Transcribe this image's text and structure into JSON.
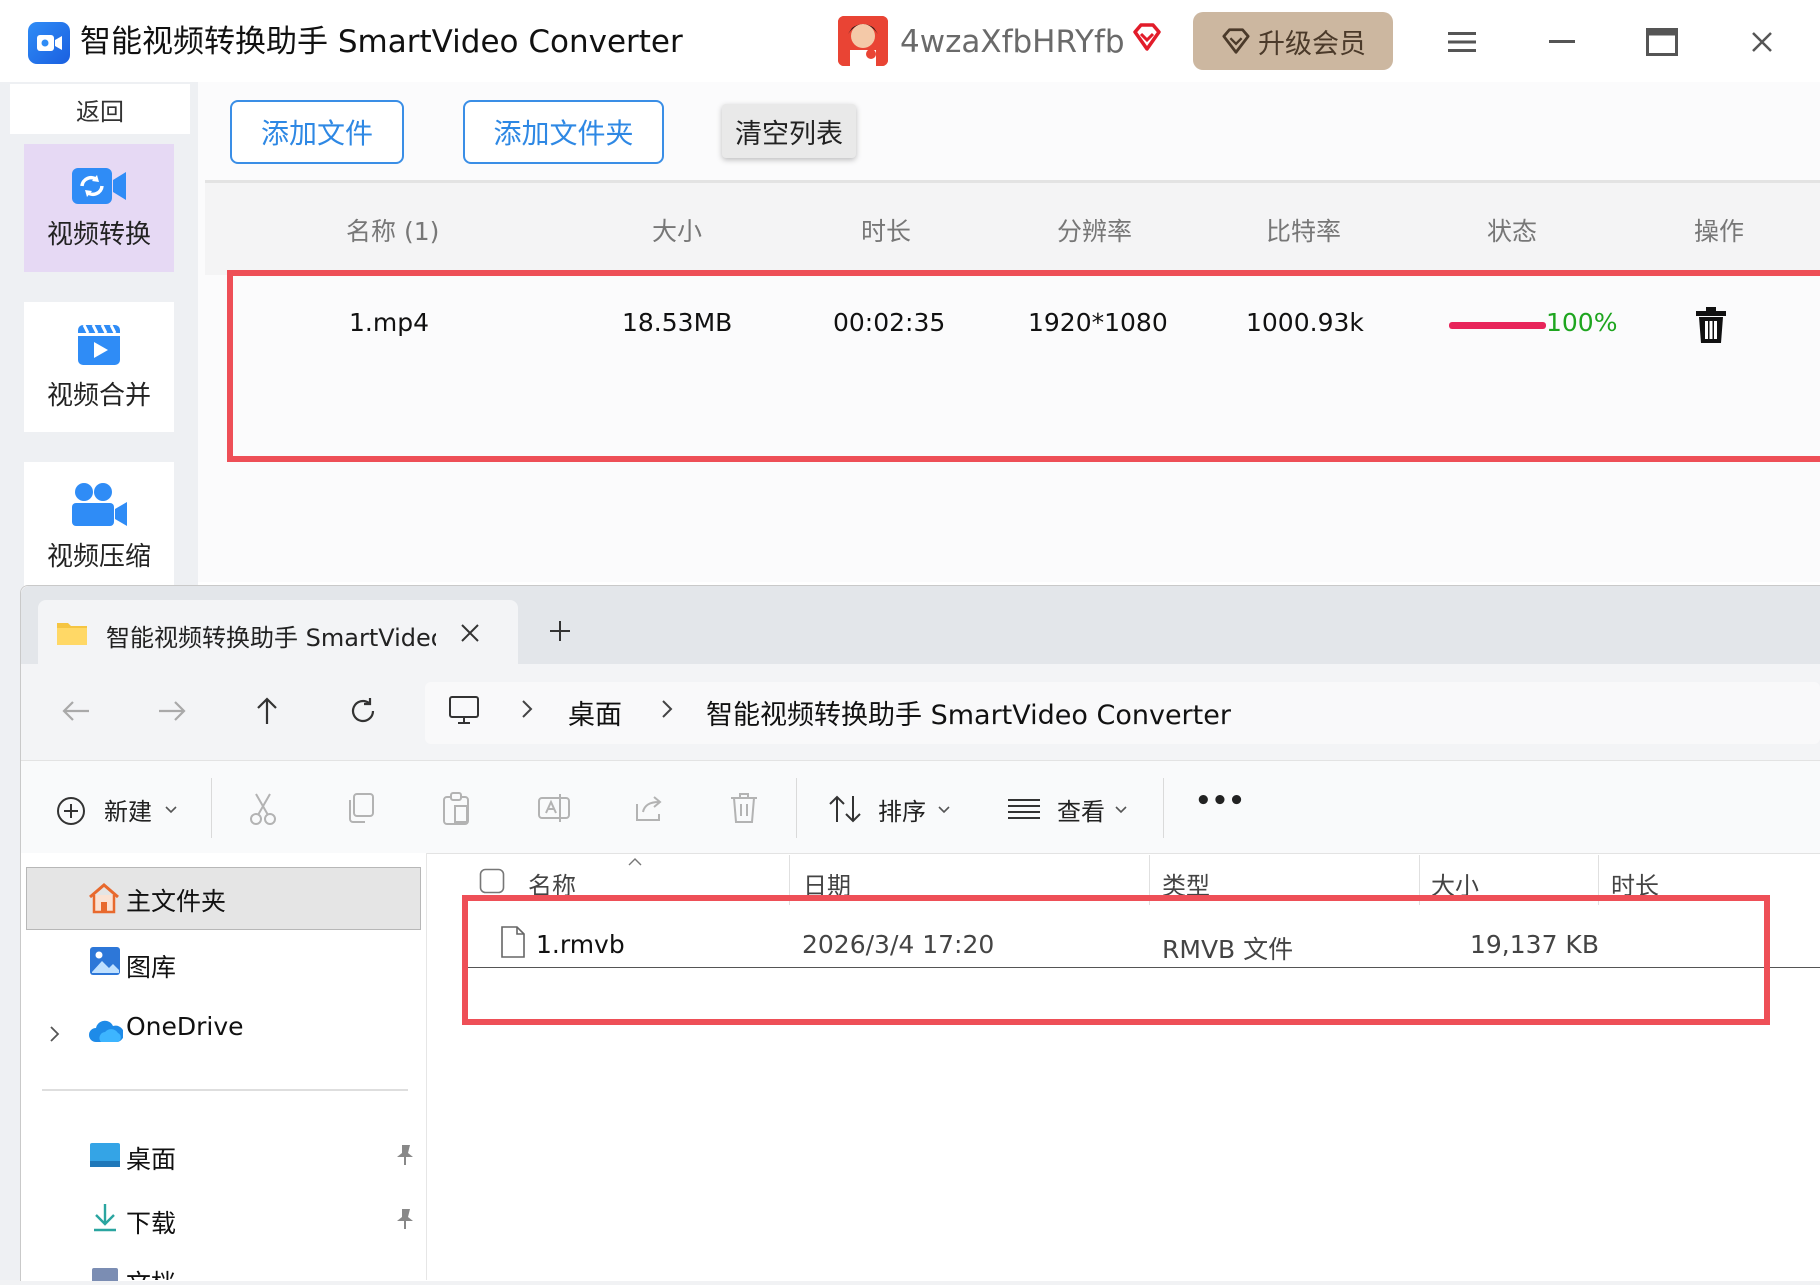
{
  "app": {
    "title": "智能视频转换助手 SmartVideo Converter",
    "username": "4wzaXfbHRYfb",
    "upgrade_label": "升级会员",
    "back_label": "返回",
    "nav": [
      {
        "label": "视频转换",
        "icon": "video-convert-icon",
        "active": true
      },
      {
        "label": "视频合并",
        "icon": "video-merge-icon",
        "active": false
      },
      {
        "label": "视频压缩",
        "icon": "video-compress-icon",
        "active": false
      }
    ],
    "toolbar": {
      "add_file": "添加文件",
      "add_folder": "添加文件夹",
      "clear_list": "清空列表"
    },
    "table": {
      "headers": [
        "名称 (1)",
        "大小",
        "时长",
        "分辨率",
        "比特率",
        "状态",
        "操作"
      ],
      "rows": [
        {
          "name": "1.mp4",
          "size": "18.53MB",
          "duration": "00:02:35",
          "resolution": "1920*1080",
          "bitrate": "1000.93k",
          "progress": 100,
          "progress_text": "100%"
        }
      ]
    },
    "colors": {
      "accent": "#3a8ee6",
      "highlight": "#ee4f57",
      "progress": "#e8245a",
      "success": "#1ea51f",
      "vip": "#ccb7a0"
    }
  },
  "explorer": {
    "tab_title": "智能视频转换助手 SmartVideo Converter",
    "breadcrumb": [
      "桌面",
      "智能视频转换助手 SmartVideo Converter"
    ],
    "toolbar": {
      "new": "新建",
      "sort": "排序",
      "view": "查看",
      "more": "•••"
    },
    "nav_pane": {
      "home": "主文件夹",
      "gallery": "图库",
      "onedrive": "OneDrive",
      "desktop": "桌面",
      "downloads": "下载",
      "documents": "文档"
    },
    "columns": [
      "名称",
      "日期",
      "类型",
      "大小",
      "时长"
    ],
    "files": [
      {
        "name": "1.rmvb",
        "date": "2026/3/4 17:20",
        "type": "RMVB 文件",
        "size": "19,137 KB",
        "duration": ""
      }
    ]
  }
}
